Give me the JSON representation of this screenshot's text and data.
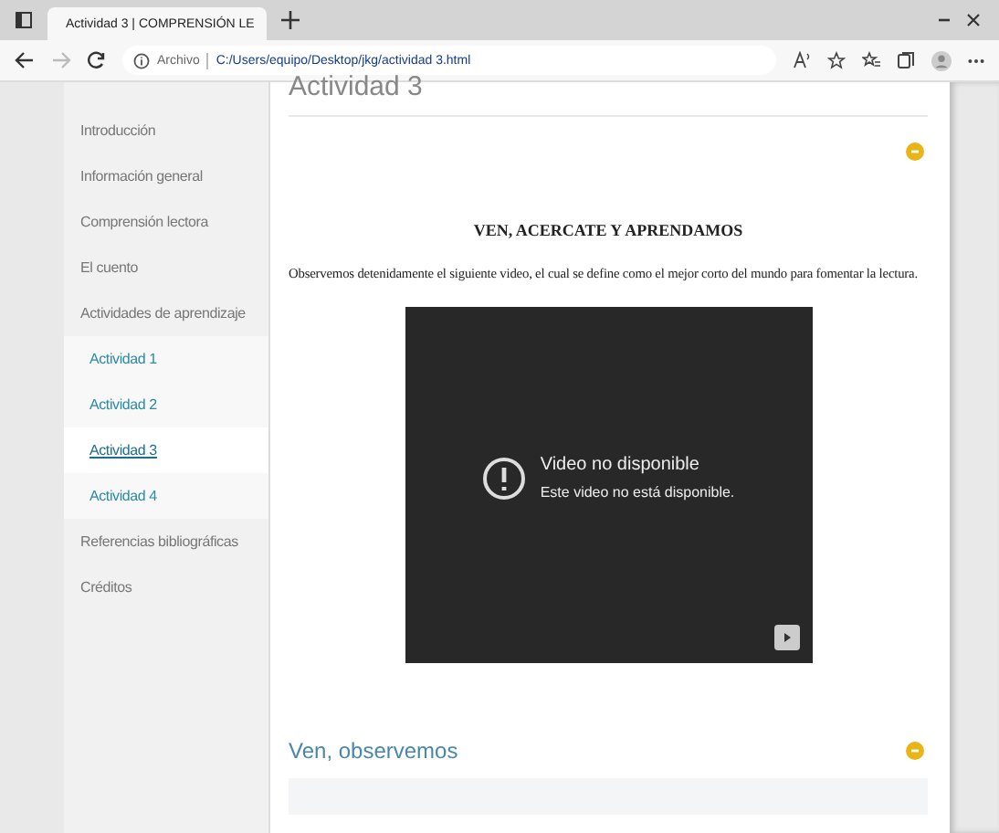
{
  "browser": {
    "tab_title": "Actividad 3 | COMPRENSIÓN LE",
    "address_label": "Archivo",
    "url": "C:/Users/equipo/Desktop/jkg/actividad 3.html"
  },
  "sidebar": {
    "items": [
      {
        "label": "Introducción",
        "selected": false
      },
      {
        "label": "Información general",
        "selected": false
      },
      {
        "label": "Comprensión lectora",
        "selected": false
      },
      {
        "label": "El cuento",
        "selected": false
      },
      {
        "label": "Actividades de aprendizaje",
        "selected": false,
        "children": [
          {
            "label": "Actividad 1",
            "selected": false
          },
          {
            "label": "Actividad 2",
            "selected": false
          },
          {
            "label": "Actividad 3",
            "selected": true
          },
          {
            "label": "Actividad 4",
            "selected": false
          }
        ]
      },
      {
        "label": "Referencias bibliográficas",
        "selected": false
      },
      {
        "label": "Créditos",
        "selected": false
      }
    ]
  },
  "content": {
    "title": "Actividad 3",
    "sections": [
      {
        "heading": "VEN, ACERCATE Y APRENDAMOS",
        "paragraph": "Observemos detenidamente el siguiente video, el cual se define como el mejor corto del mundo para fomentar la lectura.",
        "video": {
          "title": "Video no disponible",
          "message": "Este video no está disponible."
        }
      },
      {
        "title": "Ven, observemos"
      }
    ]
  }
}
